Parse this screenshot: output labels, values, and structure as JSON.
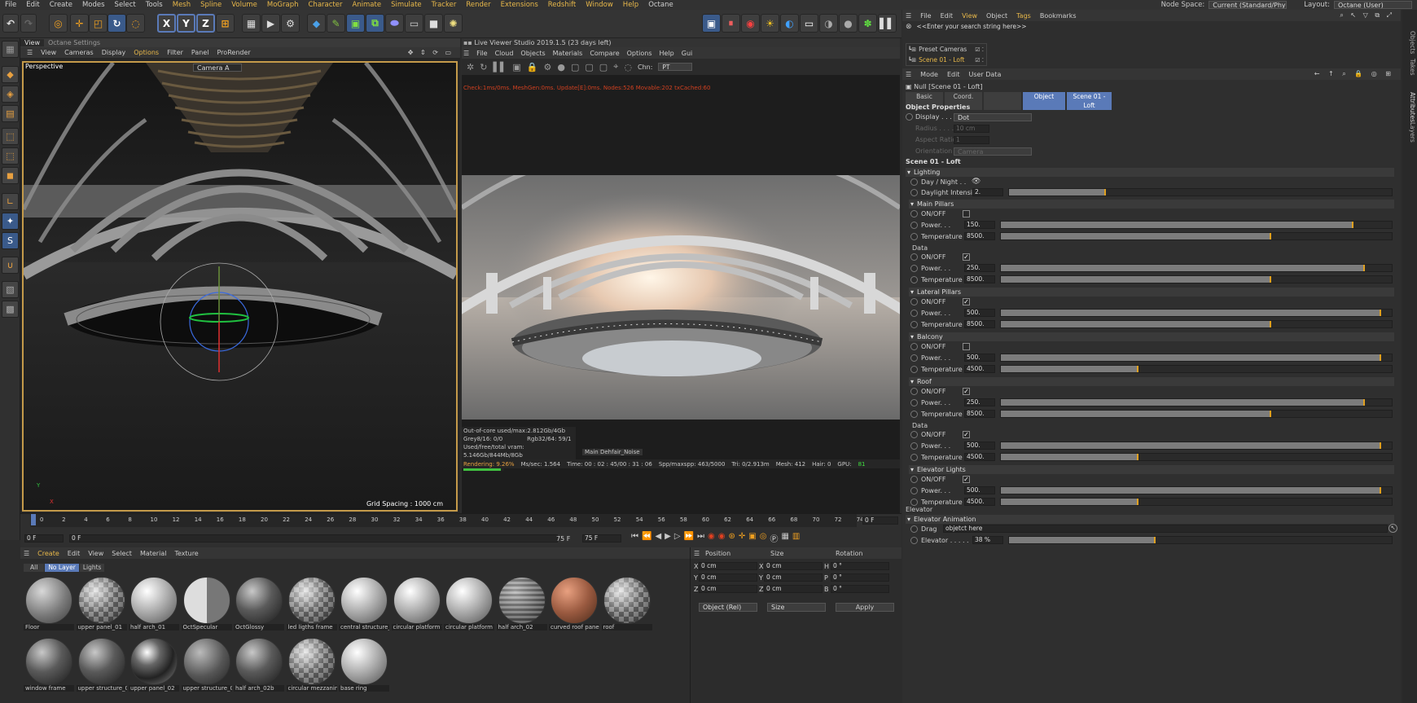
{
  "menubar": {
    "items": [
      "File",
      "Edit",
      "Create",
      "Modes",
      "Select",
      "Tools",
      "Mesh",
      "Spline",
      "Volume",
      "MoGraph",
      "Character",
      "Animate",
      "Simulate",
      "Tracker",
      "Render",
      "Extensions",
      "Redshift",
      "Window",
      "Help",
      "Octane"
    ],
    "node_space_label": "Node Space:",
    "node_space_value": "Current (Standard/Physical)",
    "layout_label": "Layout:",
    "layout_value": "Octane (User)"
  },
  "viewport": {
    "tabs": [
      "View",
      "Octane Settings"
    ],
    "menu": [
      "View",
      "Cameras",
      "Display",
      "Options",
      "Filter",
      "Panel",
      "ProRender"
    ],
    "label": "Perspective",
    "camera": "Camera A",
    "grid_spacing": "Grid Spacing : 1000 cm",
    "axis_y": "Y",
    "axis_x": "X"
  },
  "live_viewer": {
    "title": "Live Viewer Studio 2019.1.5 (23 days left)",
    "menu": [
      "File",
      "Cloud",
      "Objects",
      "Materials",
      "Compare",
      "Options",
      "Help",
      "Gui"
    ],
    "chn_label": "Chn:",
    "chn_value": "PT",
    "check": "Check:1ms/0ms. MeshGen:0ms. Update[E]:0ms. Nodes:526 Movable:202 txCached:60",
    "stats1": "Out-of-core used/max:2.812Gb/4Gb",
    "stats2a": "Grey8/16: 0/0",
    "stats2b": "Rgb32/64: 59/1",
    "stats3": "Used/free/total vram: 5.146Gb/844Mb/8Gb",
    "main_tab": "Main",
    "dehair": "Dehfair_Noise",
    "rendering": "Rendering: 9.26%",
    "mssec": "Ms/sec: 1.564",
    "time": "Time: 00 : 02 : 45/00 : 31 : 06",
    "spp": "Spp/maxspp: 463/5000",
    "tri": "Tri: 0/2.913m",
    "mesh": "Mesh: 412",
    "hair": "Hair: 0",
    "gpu": "GPU:",
    "gpu_val": "81",
    "progress": 0.0926
  },
  "objects": {
    "menu": [
      "File",
      "Edit",
      "View",
      "Object",
      "Tags",
      "Bookmarks"
    ],
    "search_placeholder": "<<Enter your search string here>>",
    "items": [
      "Preset Cameras",
      "Scene 01 - Loft"
    ]
  },
  "attributes": {
    "menu": [
      "Mode",
      "Edit",
      "User Data"
    ],
    "null_label": "Null [Scene 01 - Loft]",
    "tabs": [
      "Basic",
      "Coord.",
      "Object",
      "Scene 01 - Loft"
    ],
    "obj_props": "Object Properties",
    "display_label": "Display . . . .",
    "display_value": "Dot",
    "radius_label": "Radius . . . .",
    "radius_value": "10 cm",
    "aspect_label": "Aspect Ratio",
    "aspect_value": "1",
    "orientation_label": "Orientation",
    "orientation_value": "Camera",
    "scene_title": "Scene 01 - Loft",
    "lighting": "Lighting",
    "daynight": "Day / Night . .",
    "daylight_label": "Daylight Intensity",
    "daylight_value": "2.",
    "daylight_level": 0.25,
    "groups": [
      {
        "title": "Main Pillars",
        "rows": [
          {
            "type": "check",
            "label": "ON/OFF",
            "checked": false
          },
          {
            "type": "slider",
            "label": "Power. . .",
            "value": "150.",
            "level": 0.9
          },
          {
            "type": "slider",
            "label": "Temperature",
            "value": "8500.",
            "level": 0.69
          }
        ]
      },
      {
        "title": "Data",
        "sub": true,
        "rows": [
          {
            "type": "check",
            "label": "ON/OFF",
            "checked": true
          },
          {
            "type": "slider",
            "label": "Power. . .",
            "value": "250.",
            "level": 0.93
          },
          {
            "type": "slider",
            "label": "Temperature",
            "value": "8500.",
            "level": 0.69
          }
        ]
      },
      {
        "title": "Lateral Pillars",
        "rows": [
          {
            "type": "check",
            "label": "ON/OFF",
            "checked": true
          },
          {
            "type": "slider",
            "label": "Power. . .",
            "value": "500.",
            "level": 0.97
          },
          {
            "type": "slider",
            "label": "Temperature",
            "value": "8500.",
            "level": 0.69
          }
        ]
      },
      {
        "title": "Balcony",
        "rows": [
          {
            "type": "check",
            "label": "ON/OFF",
            "checked": false
          },
          {
            "type": "slider",
            "label": "Power. . .",
            "value": "500.",
            "level": 0.97
          },
          {
            "type": "slider",
            "label": "Temperature",
            "value": "4500.",
            "level": 0.35
          }
        ]
      },
      {
        "title": "Roof",
        "rows": [
          {
            "type": "check",
            "label": "ON/OFF",
            "checked": true
          },
          {
            "type": "slider",
            "label": "Power. . .",
            "value": "250.",
            "level": 0.93
          },
          {
            "type": "slider",
            "label": "Temperature",
            "value": "8500.",
            "level": 0.69
          }
        ]
      },
      {
        "title": "Data",
        "sub": true,
        "rows": [
          {
            "type": "check",
            "label": "ON/OFF",
            "checked": true
          },
          {
            "type": "slider",
            "label": "Power. . .",
            "value": "500.",
            "level": 0.97
          },
          {
            "type": "slider",
            "label": "Temperature",
            "value": "4500.",
            "level": 0.35
          }
        ]
      },
      {
        "title": "Elevator Lights",
        "rows": [
          {
            "type": "check",
            "label": "ON/OFF",
            "checked": true
          },
          {
            "type": "slider",
            "label": "Power. . .",
            "value": "500.",
            "level": 0.97
          },
          {
            "type": "slider",
            "label": "Temperature",
            "value": "4500.",
            "level": 0.35
          }
        ]
      }
    ],
    "elevator": "Elevator",
    "elevator_anim": "Elevator Animation",
    "drag_label": "Drag",
    "drag_value": "objetct here",
    "elevator_label": "Elevator . . . . .",
    "elevator_value": "38 %",
    "elevator_level": 0.38
  },
  "sidetabs": [
    "Objects",
    "Takes",
    "Attributes",
    "Layers"
  ],
  "timeline": {
    "ticks": [
      "0",
      "2",
      "4",
      "6",
      "8",
      "10",
      "12",
      "14",
      "16",
      "18",
      "20",
      "22",
      "24",
      "26",
      "28",
      "30",
      "32",
      "34",
      "36",
      "38",
      "40",
      "42",
      "44",
      "46",
      "48",
      "50",
      "52",
      "54",
      "56",
      "58",
      "60",
      "62",
      "64",
      "66",
      "68",
      "70",
      "72",
      "74"
    ],
    "end_frame": "0 F",
    "frame_start": "0 F",
    "frame_cur": "0 F",
    "frame_end": "75 F",
    "frame_max": "75 F"
  },
  "materials": {
    "menu": [
      "Create",
      "Edit",
      "View",
      "Select",
      "Material",
      "Texture"
    ],
    "filters": [
      "All",
      "No Layer",
      "Lights"
    ],
    "items": [
      {
        "name": "Floor",
        "style": "gray"
      },
      {
        "name": "upper panel_01",
        "style": "checker"
      },
      {
        "name": "half arch_01",
        "style": "light"
      },
      {
        "name": "OctSpecular",
        "style": "checker2"
      },
      {
        "name": "OctGlossy",
        "style": "dark"
      },
      {
        "name": "led ligths frame",
        "style": "checker"
      },
      {
        "name": "central structure_",
        "style": "light"
      },
      {
        "name": "circular platform t",
        "style": "light"
      },
      {
        "name": "circular platform r",
        "style": "light"
      },
      {
        "name": "half arch_02",
        "style": "stripe"
      },
      {
        "name": "curved roof panel",
        "style": "copper"
      },
      {
        "name": "roof",
        "style": "checker"
      },
      {
        "name": "window frame",
        "style": "dark"
      },
      {
        "name": "upper structure_0",
        "style": "dark"
      },
      {
        "name": "upper panel_02",
        "style": "glass"
      },
      {
        "name": "upper structure_0",
        "style": "noise"
      },
      {
        "name": "half arch_02b",
        "style": "dark"
      },
      {
        "name": "circular mezzanin",
        "style": "checker"
      },
      {
        "name": "base ring",
        "style": "light"
      }
    ]
  },
  "coords": {
    "headers": [
      "Position",
      "Size",
      "Rotation"
    ],
    "rows": [
      {
        "a": "X",
        "av": "0 cm",
        "b": "X",
        "bv": "0 cm",
        "c": "H",
        "cv": "0 °"
      },
      {
        "a": "Y",
        "av": "0 cm",
        "b": "Y",
        "bv": "0 cm",
        "c": "P",
        "cv": "0 °"
      },
      {
        "a": "Z",
        "av": "0 cm",
        "b": "Z",
        "bv": "0 cm",
        "c": "B",
        "cv": "0 °"
      }
    ],
    "mode": "Object (Rel)",
    "size_mode": "Size",
    "apply": "Apply"
  }
}
